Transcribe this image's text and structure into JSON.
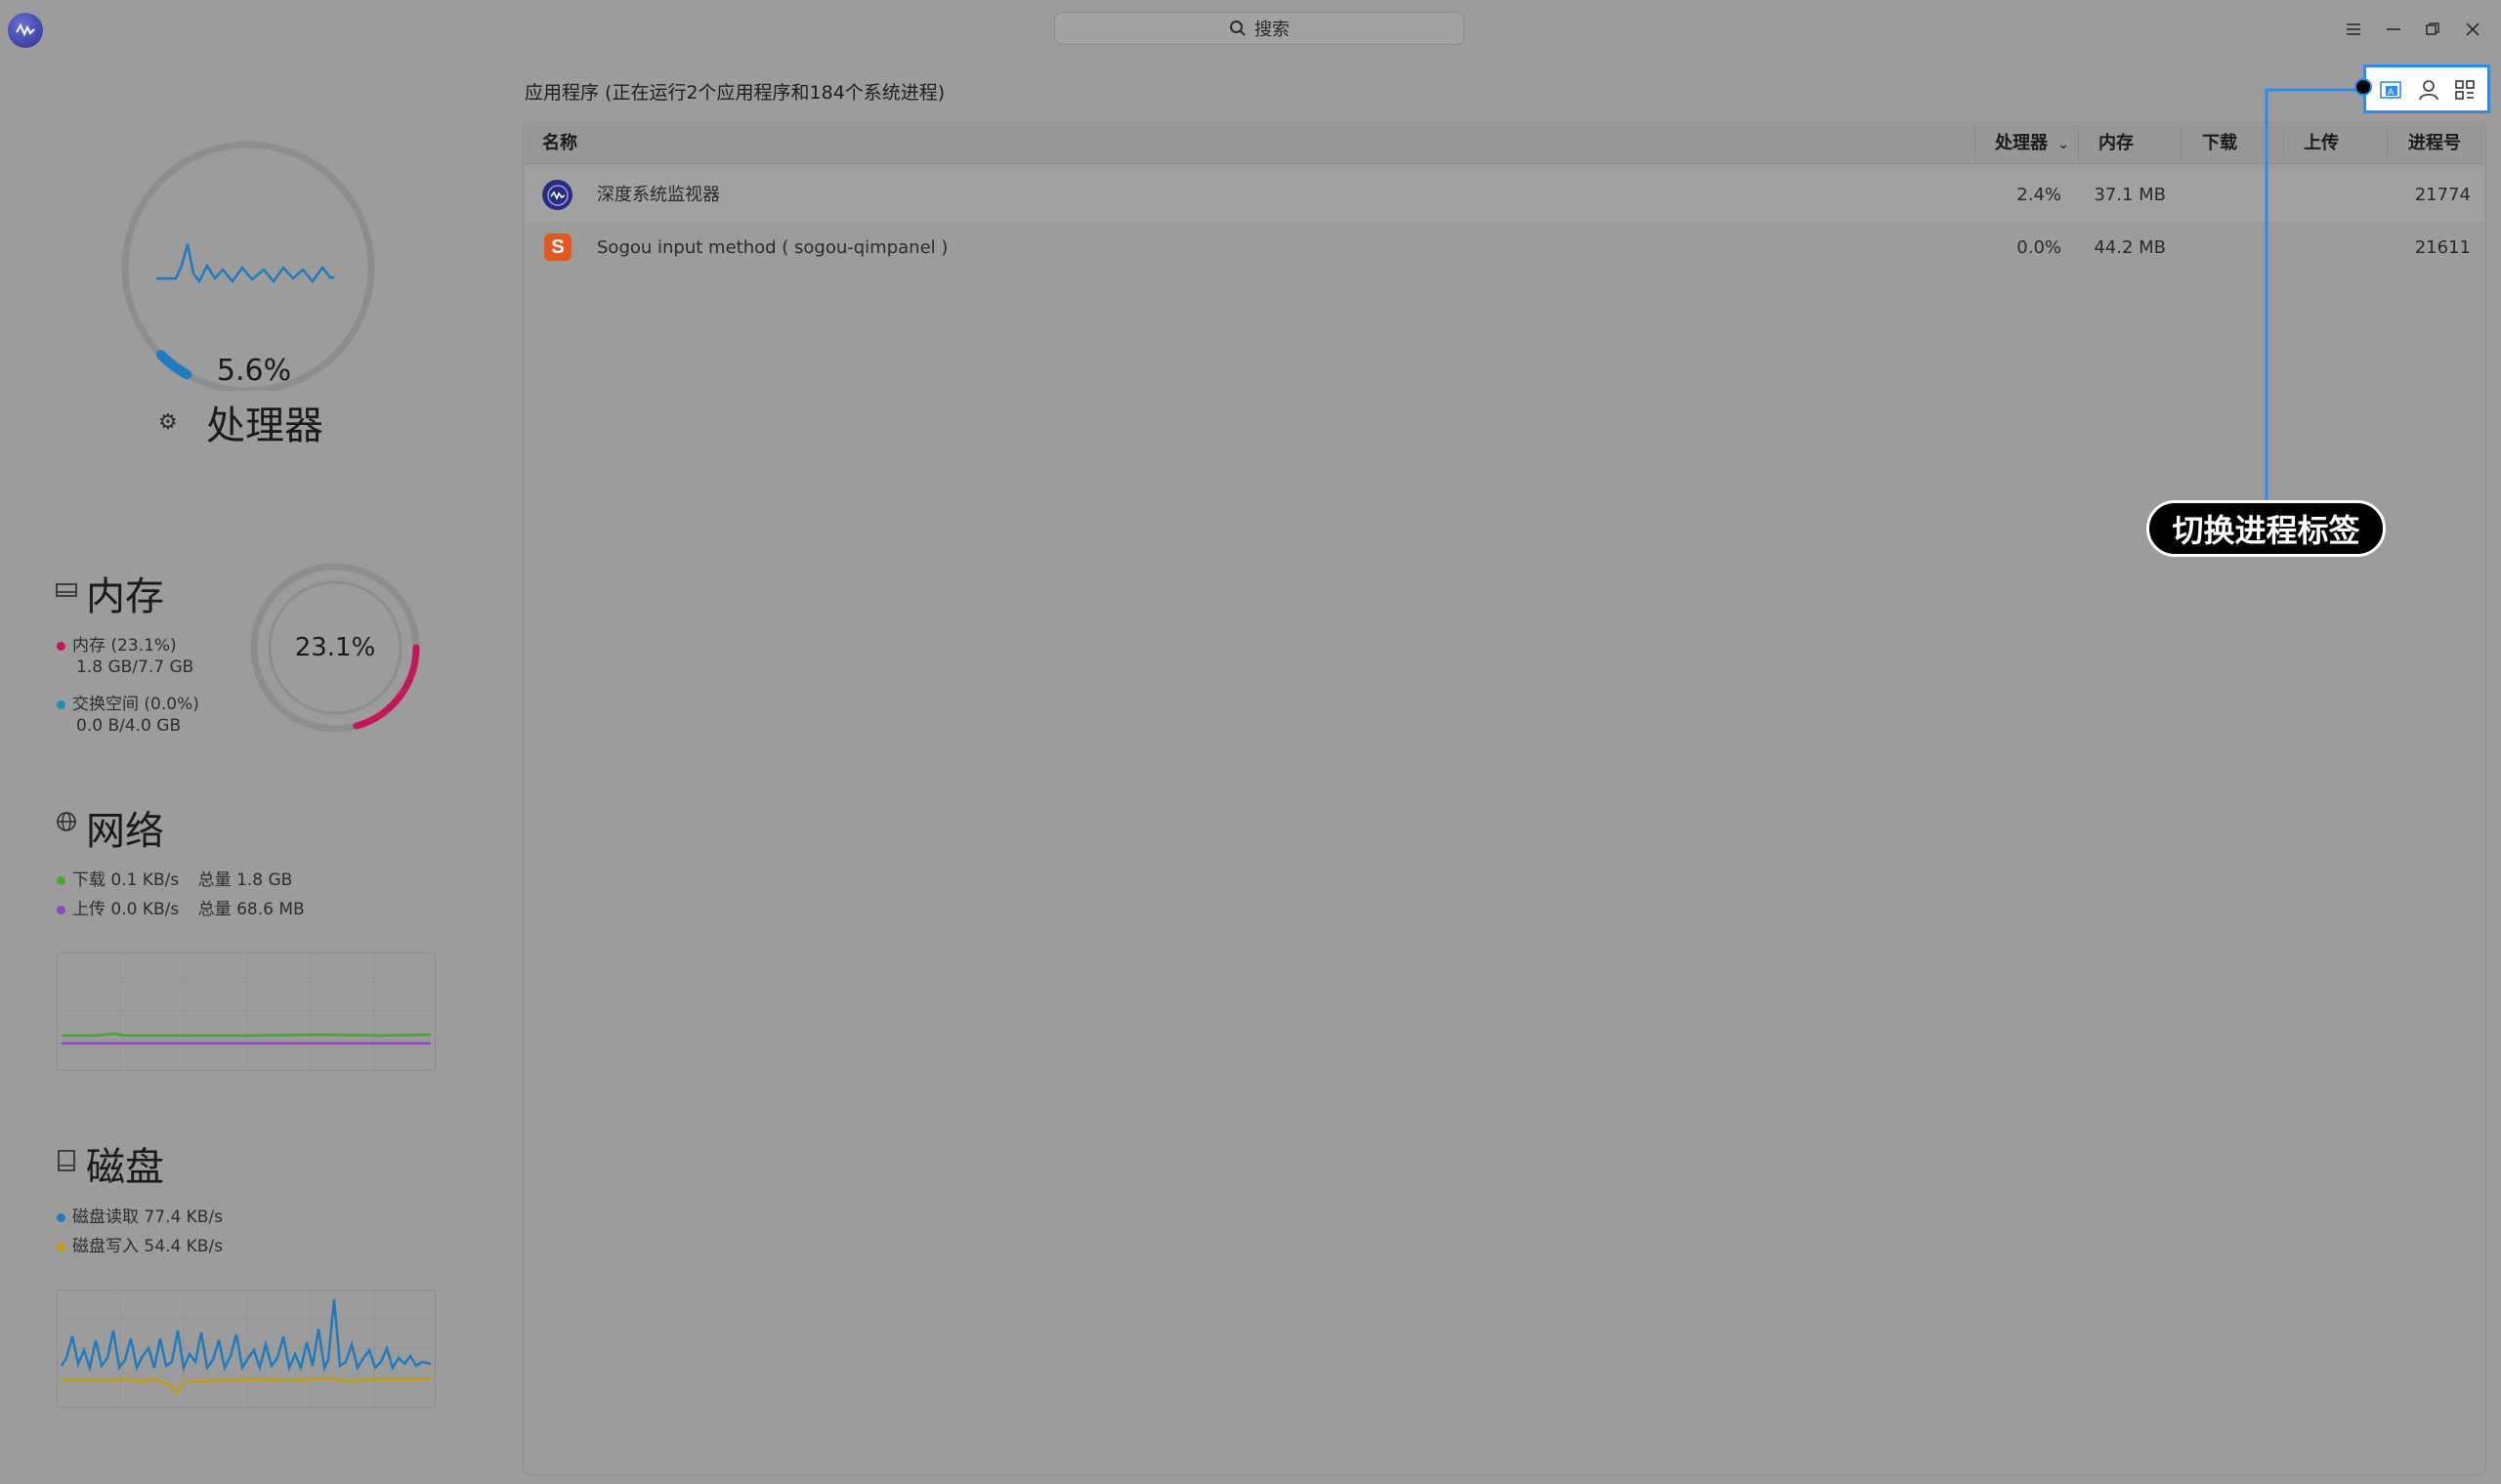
{
  "titlebar": {
    "search_placeholder": "搜索",
    "icons": [
      "app-logo",
      "search-icon",
      "menu-icon",
      "minimize-icon",
      "restore-icon",
      "close-icon"
    ]
  },
  "cpu": {
    "percent_text": "5.6%",
    "usage": 0.056,
    "title": "处理器",
    "color": "#1f7bbf"
  },
  "memory": {
    "title": "内存",
    "mem_label": "内存 (23.1%)",
    "mem_detail": "1.8 GB/7.7 GB",
    "swap_label": "交换空间 (0.0%)",
    "swap_detail": "0.0 B/4.0 GB",
    "percent_text": "23.1%",
    "usage": 0.231,
    "mem_color": "#c2185b",
    "swap_color": "#1f8fb0"
  },
  "network": {
    "title": "网络",
    "download_label": "下载",
    "download_speed": "0.1 KB/s",
    "download_total_label": "总量",
    "download_total": "1.8 GB",
    "upload_label": "上传",
    "upload_speed": "0.0 KB/s",
    "upload_total_label": "总量",
    "upload_total": "68.6 MB",
    "download_color": "#4aa52e",
    "upload_color": "#8e44c8"
  },
  "disk": {
    "title": "磁盘",
    "read_label": "磁盘读取",
    "read_speed": "77.4 KB/s",
    "write_label": "磁盘写入",
    "write_speed": "54.4 KB/s",
    "read_color": "#1f7bbf",
    "write_color": "#c49a10"
  },
  "process_panel": {
    "summary": "应用程序 (正在运行2个应用程序和184个系统进程)",
    "columns": {
      "name": "名称",
      "cpu": "处理器",
      "memory": "内存",
      "download": "下载",
      "upload": "上传",
      "pid": "进程号"
    },
    "rows": [
      {
        "name": "深度系统监视器",
        "cpu": "2.4%",
        "memory": "37.1 MB",
        "download": "",
        "upload": "",
        "pid": "21774",
        "icon": "deepin-monitor-icon"
      },
      {
        "name": "Sogou input method ( sogou-qimpanel )",
        "cpu": "0.0%",
        "memory": "44.2 MB",
        "download": "",
        "upload": "",
        "pid": "21611",
        "icon": "sogou-icon"
      }
    ]
  },
  "tab_switcher": {
    "tabs": [
      "app-process-tab-icon",
      "user-process-tab-icon",
      "all-process-tab-icon"
    ]
  },
  "callout": {
    "label": "切换进程标签",
    "color": "#2d8cf0"
  }
}
